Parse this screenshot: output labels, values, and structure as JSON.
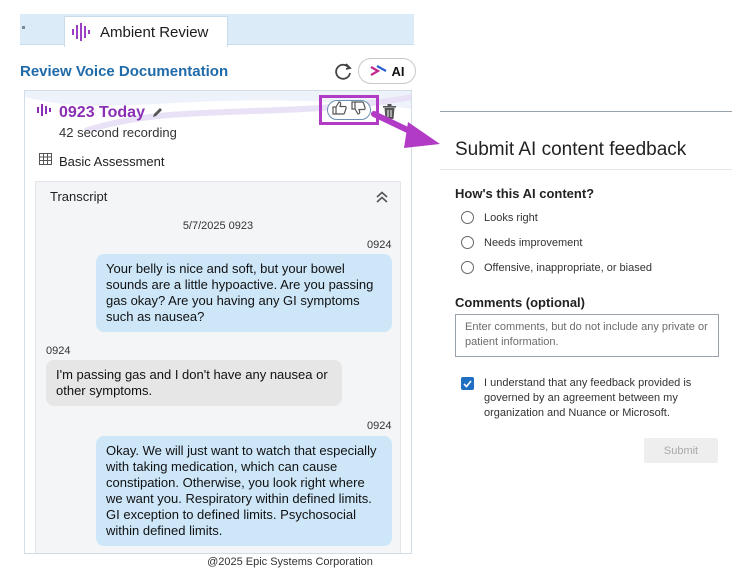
{
  "left": {
    "tab": {
      "label": "Ambient Review",
      "icon": "waveform-icon"
    },
    "header": {
      "title": "Review Voice Documentation",
      "refresh_icon": "refresh-icon",
      "ai_label": "AI"
    },
    "note": {
      "title": "0923 Today",
      "recording_length": "42 second recording",
      "assessment": "Basic Assessment"
    },
    "transcript": {
      "label": "Transcript",
      "date": "5/7/2025 0923",
      "messages": [
        {
          "speaker": "clinician",
          "time": "0924",
          "text": "Your belly is nice and soft, but your bowel sounds are a little hypoactive. Are you passing gas okay? Are you having any GI symptoms such as nausea?"
        },
        {
          "speaker": "patient",
          "time": "0924",
          "text": "I'm passing gas and I don't have any nausea or other symptoms."
        },
        {
          "speaker": "clinician",
          "time": "0924",
          "text": "Okay. We will just want to watch that especially with taking medication, which can cause constipation. Otherwise, you look right where we want you. Respiratory within defined limits. GI exception to defined limits. Psychosocial within defined limits."
        }
      ]
    },
    "copyright": "@2025 Epic Systems Corporation"
  },
  "feedback": {
    "title": "Submit AI content feedback",
    "question": "How's this AI content?",
    "options": [
      "Looks right",
      "Needs improvement",
      "Offensive, inappropriate, or biased"
    ],
    "comments_label": "Comments (optional)",
    "comments_placeholder": "Enter comments, but do not include any private or patient information.",
    "agreement": "I understand that any feedback provided is governed by an agreement between my organization and Nuance or Microsoft.",
    "agreement_checked": true,
    "submit_label": "Submit"
  },
  "colors": {
    "link_blue": "#1f6aa8",
    "note_purple": "#8a2fb4",
    "highlight_magenta": "#b23bc6",
    "bubble_clinician": "#cde6f8",
    "bubble_patient": "#e6e6e6",
    "checkbox_blue": "#1e6fc2"
  }
}
